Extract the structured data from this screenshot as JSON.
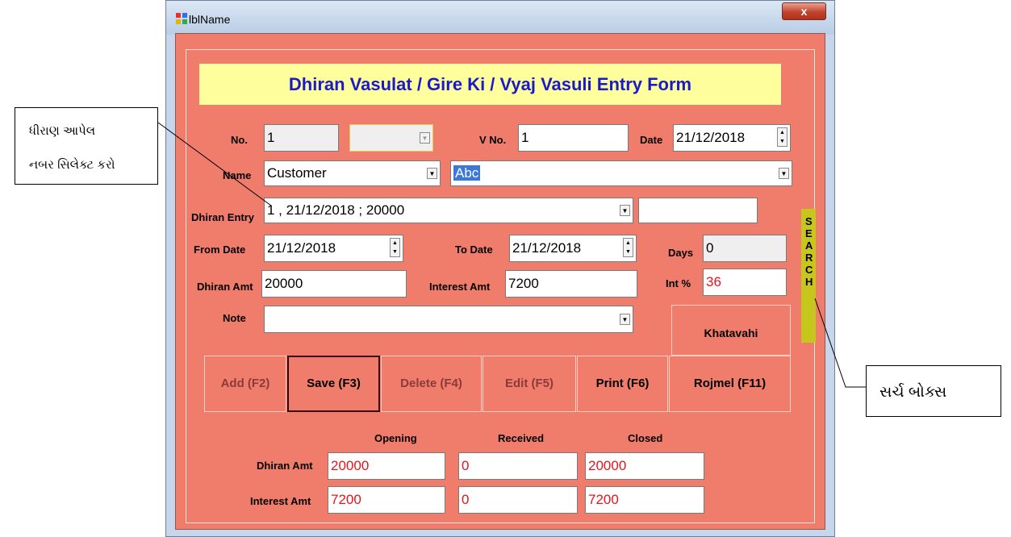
{
  "window": {
    "title": "lblName",
    "close_label": "x"
  },
  "form": {
    "banner": "Dhiran Vasulat / Gire Ki /  Vyaj Vasuli   Entry Form",
    "no": {
      "label": "No.",
      "value": "1",
      "combo_value": ""
    },
    "vno": {
      "label": "V No.",
      "value": "1"
    },
    "date": {
      "label": "Date",
      "value": "21/12/2018"
    },
    "name": {
      "label": "Name",
      "type_value": "Customer",
      "name_value": "Abc"
    },
    "dhiran_entry": {
      "label": "Dhiran Entry",
      "value": "1 , 21/12/2018 ; 20000",
      "extra_value": ""
    },
    "from_date": {
      "label": "From Date",
      "value": "21/12/2018"
    },
    "to_date": {
      "label": "To Date",
      "value": "21/12/2018"
    },
    "days": {
      "label": "Days",
      "value": "0"
    },
    "dhiran_amt": {
      "label": "Dhiran Amt",
      "value": "20000"
    },
    "interest_amt": {
      "label": "Interest Amt",
      "value": "7200"
    },
    "int_pct": {
      "label": "Int %",
      "value": "36"
    },
    "note": {
      "label": "Note",
      "value": ""
    },
    "khatavahi_label": "Khatavahi",
    "search_label": "SEARCH"
  },
  "buttons": [
    {
      "label": "Add (F2)",
      "state": "disabled"
    },
    {
      "label": "Save (F3)",
      "state": "active"
    },
    {
      "label": "Delete (F4)",
      "state": "disabled"
    },
    {
      "label": "Edit (F5)",
      "state": "disabled"
    },
    {
      "label": "Print (F6)",
      "state": "enabled"
    },
    {
      "label": "Rojmel (F11)",
      "state": "enabled"
    }
  ],
  "summary": {
    "headers": [
      "Opening",
      "Received",
      "Closed"
    ],
    "rows": [
      {
        "label": "Dhiran Amt",
        "values": [
          "20000",
          "0",
          "20000"
        ]
      },
      {
        "label": "Interest Amt",
        "values": [
          "7200",
          "0",
          "7200"
        ]
      }
    ]
  },
  "callouts": {
    "left_line1": "ધીરાણ આપેલ",
    "left_line2": "નબર સિલેક્ટ કરો",
    "right": "સર્ચ બોક્સ"
  }
}
